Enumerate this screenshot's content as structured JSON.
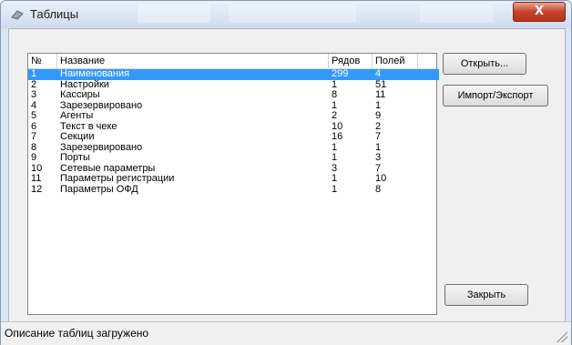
{
  "window": {
    "title": "Таблицы",
    "close_label": "X"
  },
  "table": {
    "columns": [
      "№",
      "Название",
      "Рядов",
      "Полей"
    ],
    "rows": [
      {
        "num": "1",
        "name": "Наименования",
        "rows": "299",
        "fields": "4"
      },
      {
        "num": "2",
        "name": "Настройки",
        "rows": "1",
        "fields": "51"
      },
      {
        "num": "3",
        "name": "Кассиры",
        "rows": "8",
        "fields": "11"
      },
      {
        "num": "4",
        "name": "Зарезервировано",
        "rows": "1",
        "fields": "1"
      },
      {
        "num": "5",
        "name": "Агенты",
        "rows": "2",
        "fields": "9"
      },
      {
        "num": "6",
        "name": "Текст в чеке",
        "rows": "10",
        "fields": "2"
      },
      {
        "num": "7",
        "name": "Секции",
        "rows": "16",
        "fields": "7"
      },
      {
        "num": "8",
        "name": "Зарезервировано",
        "rows": "1",
        "fields": "1"
      },
      {
        "num": "9",
        "name": "Порты",
        "rows": "1",
        "fields": "3"
      },
      {
        "num": "10",
        "name": "Сетевые параметры",
        "rows": "3",
        "fields": "7"
      },
      {
        "num": "11",
        "name": "Параметры регистрации",
        "rows": "1",
        "fields": "10"
      },
      {
        "num": "12",
        "name": "Параметры ОФД",
        "rows": "1",
        "fields": "8"
      }
    ],
    "selected_index": 0
  },
  "buttons": {
    "open": "Открыть...",
    "import_export": "Импорт/Экспорт",
    "close": "Закрыть"
  },
  "status": {
    "text": "Описание таблиц загружено"
  },
  "colors": {
    "selection": "#3399ff",
    "close_button": "#c7422a"
  }
}
